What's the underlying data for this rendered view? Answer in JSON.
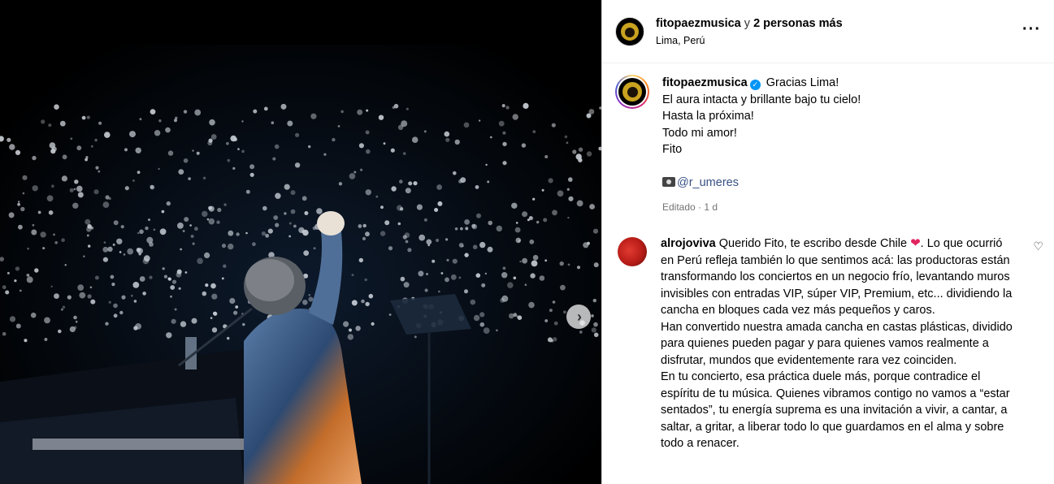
{
  "header": {
    "username": "fitopaezmusica",
    "conjunction": "y",
    "others": "2 personas más",
    "location": "Lima, Perú"
  },
  "caption": {
    "username": "fitopaezmusica",
    "lines": [
      "Gracias Lima!",
      "El aura intacta y brillante bajo tu cielo!",
      "Hasta la próxima!",
      "Todo mi amor!",
      "Fito"
    ],
    "mention": "@r_umeres",
    "meta": "Editado · 1 d"
  },
  "comment": {
    "username": "alrojoviva",
    "text_intro": "Querido Fito, te escribo desde Chile",
    "text_after_heart": ". Lo que ocurrió en Perú refleja también lo que sentimos acá: las productoras están transformando los conciertos en un negocio frío, levantando muros invisibles con entradas VIP, súper VIP, Premium, etc... dividiendo la cancha en bloques cada vez más pequeños y caros.",
    "paragraph2": "Han convertido nuestra amada cancha en castas plásticas, dividido para quienes pueden pagar y para quienes vamos realmente a disfrutar, mundos que evidentemente rara vez coinciden.",
    "paragraph3": "En tu concierto, esa práctica duele más, porque contradice el espíritu de tu música. Quienes vibramos contigo no vamos a “estar sentados”, tu energía suprema es una invitación a vivir, a cantar, a saltar, a gritar, a liberar todo lo que guardamos en el alma y sobre todo a renacer."
  },
  "icons": {
    "more": "more-options-icon",
    "verified": "verified-badge-icon",
    "camera": "camera-icon",
    "heart": "heart-emoji-icon",
    "like": "like-heart-icon",
    "next": "chevron-right-icon"
  },
  "colors": {
    "verified": "#0095f6",
    "mention": "#385185",
    "meta": "#737373"
  }
}
